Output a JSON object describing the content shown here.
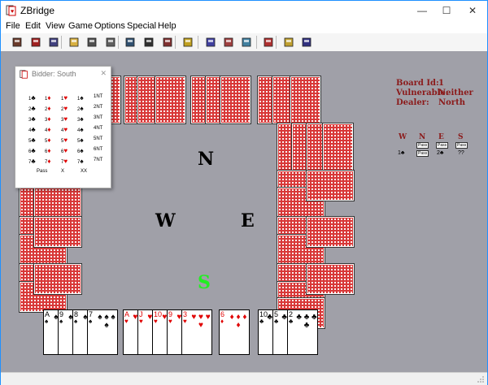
{
  "window": {
    "title": "ZBridge",
    "controls": {
      "minimize": "—",
      "maximize": "☐",
      "close": "✕"
    }
  },
  "menu": [
    "File",
    "Edit",
    "View",
    "Game",
    "Options",
    "Special",
    "Help"
  ],
  "toolbar": {
    "buttons": [
      {
        "name": "new-game-icon",
        "color": "#6a3a2a"
      },
      {
        "name": "deal-icon",
        "color": "#a02020"
      },
      {
        "name": "open-hand-icon",
        "color": "#404080"
      },
      {
        "name": "open-folder-icon",
        "color": "#d8b040"
      },
      {
        "name": "save-icon",
        "color": "#505050"
      },
      {
        "name": "print-icon",
        "color": "#606060"
      },
      {
        "name": "undo-icon",
        "color": "#305070"
      },
      {
        "name": "rewind-icon",
        "color": "#303030"
      },
      {
        "name": "cards-icon",
        "color": "#803030"
      },
      {
        "name": "hint-icon",
        "color": "#c0a020"
      },
      {
        "name": "seat-north-icon",
        "color": "#4040a0"
      },
      {
        "name": "seat-east-icon",
        "color": "#a04040"
      },
      {
        "name": "seat-south-icon",
        "color": "#4080a0"
      },
      {
        "name": "options-icon",
        "color": "#b03030"
      },
      {
        "name": "book-icon",
        "color": "#c0a030"
      },
      {
        "name": "help-book-icon",
        "color": "#303080"
      }
    ]
  },
  "table": {
    "background": "#a0a0a8",
    "seats": {
      "north": "N",
      "west": "W",
      "east": "E",
      "south": "S"
    },
    "info": {
      "board_label": "Board Id:",
      "board_value": "1",
      "vulnerable_label": "Vulnerable:",
      "vulnerable_value": "Neither",
      "dealer_label": "Dealer:",
      "dealer_value": "North"
    },
    "auction": {
      "headers": [
        "W",
        "N",
        "E",
        "S"
      ],
      "rows": [
        [
          "",
          "Pass",
          "Pass",
          "Pass"
        ],
        [
          "1♣",
          "Pass",
          "2♣",
          "??"
        ]
      ]
    },
    "south_hand": [
      {
        "rank": "A",
        "suit": "♠",
        "color": "black"
      },
      {
        "rank": "9",
        "suit": "♠",
        "color": "black"
      },
      {
        "rank": "8",
        "suit": "♠",
        "color": "black"
      },
      {
        "rank": "7",
        "suit": "♠",
        "color": "black"
      },
      {
        "rank": "A",
        "suit": "♥",
        "color": "red"
      },
      {
        "rank": "J",
        "suit": "♥",
        "color": "red"
      },
      {
        "rank": "10",
        "suit": "♥",
        "color": "red"
      },
      {
        "rank": "9",
        "suit": "♥",
        "color": "red"
      },
      {
        "rank": "3",
        "suit": "♥",
        "color": "red"
      },
      {
        "rank": "6",
        "suit": "♦",
        "color": "red"
      },
      {
        "rank": "10",
        "suit": "♣",
        "color": "black"
      },
      {
        "rank": "5",
        "suit": "♣",
        "color": "black"
      },
      {
        "rank": "2",
        "suit": "♣",
        "color": "black"
      }
    ]
  },
  "bidder": {
    "title": "Bidder: South",
    "close": "✕",
    "levels": [
      {
        "level": "1",
        "bids": [
          "♣",
          "♦",
          "♥",
          "♠",
          "NT"
        ]
      },
      {
        "level": "2",
        "bids": [
          "♣",
          "♦",
          "♥",
          "♠",
          "NT"
        ]
      },
      {
        "level": "3",
        "bids": [
          "♣",
          "♦",
          "♥",
          "♠",
          "NT"
        ]
      },
      {
        "level": "4",
        "bids": [
          "♣",
          "♦",
          "♥",
          "♠",
          "NT"
        ]
      },
      {
        "level": "5",
        "bids": [
          "♣",
          "♦",
          "♥",
          "♠",
          "NT"
        ]
      },
      {
        "level": "6",
        "bids": [
          "♣",
          "♦",
          "♥",
          "♠",
          "NT"
        ]
      },
      {
        "level": "7",
        "bids": [
          "♣",
          "♦",
          "♥",
          "♠",
          "NT"
        ]
      }
    ],
    "actions": [
      "Pass",
      "X",
      "XX"
    ]
  }
}
